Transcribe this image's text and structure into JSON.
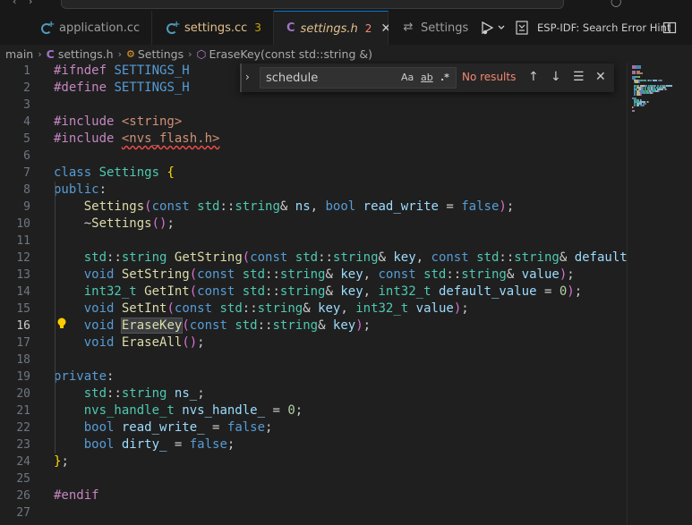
{
  "tabs": [
    {
      "label": "application.cc",
      "icon": "cpp-file-icon",
      "badge": ""
    },
    {
      "label": "settings.cc",
      "icon": "cpp-file-icon",
      "badge": "3"
    },
    {
      "label": "settings.h",
      "icon": "c-header-file-icon",
      "badge": "2",
      "active": true
    },
    {
      "label": "Settings",
      "icon": "settings-sliders-icon",
      "badge": ""
    }
  ],
  "header_icon_letter": "C",
  "toolbar": {
    "espidf_label": "ESP-IDF: Search Error Hint"
  },
  "breadcrumb": {
    "root": "main",
    "file": "settings.h",
    "class": "Settings",
    "member": "EraseKey(const std::string &)"
  },
  "find": {
    "query": "schedule",
    "result": "No results",
    "match_case": "Aa",
    "whole_word": "ab",
    "regex": ".*"
  },
  "editor": {
    "line_numbers": [
      "1",
      "2",
      "3",
      "4",
      "5",
      "6",
      "7",
      "8",
      "9",
      "10",
      "11",
      "12",
      "13",
      "14",
      "15",
      "16",
      "17",
      "18",
      "19",
      "20",
      "21",
      "22",
      "23",
      "24",
      "25",
      "26",
      "27"
    ],
    "current_line": 16,
    "lines": [
      [
        [
          "pp",
          "#ifndef "
        ],
        [
          "mac",
          "SETTINGS_H"
        ]
      ],
      [
        [
          "pp",
          "#define "
        ],
        [
          "mac",
          "SETTINGS_H"
        ]
      ],
      [],
      [
        [
          "pp",
          "#include "
        ],
        [
          "str",
          "<string>"
        ]
      ],
      [
        [
          "pp",
          "#include "
        ],
        [
          "str",
          "<nvs_flash.h>"
        ]
      ],
      [],
      [
        [
          "kw",
          "class "
        ],
        [
          "ty",
          "Settings "
        ],
        [
          "br1",
          "{"
        ]
      ],
      [
        [
          "kw",
          "public"
        ],
        [
          "plain",
          ":"
        ]
      ],
      [
        [
          "plain",
          "    "
        ],
        [
          "fn",
          "Settings"
        ],
        [
          "br2",
          "("
        ],
        [
          "kw",
          "const "
        ],
        [
          "ty",
          "std"
        ],
        [
          "plain",
          "::"
        ],
        [
          "ty",
          "string"
        ],
        [
          "plain",
          "& "
        ],
        [
          "var",
          "ns"
        ],
        [
          "plain",
          ", "
        ],
        [
          "kw",
          "bool "
        ],
        [
          "var",
          "read_write"
        ],
        [
          "plain",
          " = "
        ],
        [
          "kw",
          "false"
        ],
        [
          "br2",
          ")"
        ],
        [
          "plain",
          ";"
        ]
      ],
      [
        [
          "plain",
          "    ~"
        ],
        [
          "fn",
          "Settings"
        ],
        [
          "br2",
          "()"
        ],
        [
          "plain",
          ";"
        ]
      ],
      [],
      [
        [
          "plain",
          "    "
        ],
        [
          "ty",
          "std"
        ],
        [
          "plain",
          "::"
        ],
        [
          "ty",
          "string "
        ],
        [
          "fn",
          "GetString"
        ],
        [
          "br2",
          "("
        ],
        [
          "kw",
          "const "
        ],
        [
          "ty",
          "std"
        ],
        [
          "plain",
          "::"
        ],
        [
          "ty",
          "string"
        ],
        [
          "plain",
          "& "
        ],
        [
          "var",
          "key"
        ],
        [
          "plain",
          ", "
        ],
        [
          "kw",
          "const "
        ],
        [
          "ty",
          "std"
        ],
        [
          "plain",
          "::"
        ],
        [
          "ty",
          "string"
        ],
        [
          "plain",
          "& "
        ],
        [
          "var",
          "default_value"
        ]
      ],
      [
        [
          "plain",
          "    "
        ],
        [
          "kw",
          "void "
        ],
        [
          "fn",
          "SetString"
        ],
        [
          "br2",
          "("
        ],
        [
          "kw",
          "const "
        ],
        [
          "ty",
          "std"
        ],
        [
          "plain",
          "::"
        ],
        [
          "ty",
          "string"
        ],
        [
          "plain",
          "& "
        ],
        [
          "var",
          "key"
        ],
        [
          "plain",
          ", "
        ],
        [
          "kw",
          "const "
        ],
        [
          "ty",
          "std"
        ],
        [
          "plain",
          "::"
        ],
        [
          "ty",
          "string"
        ],
        [
          "plain",
          "& "
        ],
        [
          "var",
          "value"
        ],
        [
          "br2",
          ")"
        ],
        [
          "plain",
          ";"
        ]
      ],
      [
        [
          "plain",
          "    "
        ],
        [
          "ty",
          "int32_t "
        ],
        [
          "fn",
          "GetInt"
        ],
        [
          "br2",
          "("
        ],
        [
          "kw",
          "const "
        ],
        [
          "ty",
          "std"
        ],
        [
          "plain",
          "::"
        ],
        [
          "ty",
          "string"
        ],
        [
          "plain",
          "& "
        ],
        [
          "var",
          "key"
        ],
        [
          "plain",
          ", "
        ],
        [
          "ty",
          "int32_t "
        ],
        [
          "var",
          "default_value"
        ],
        [
          "plain",
          " = "
        ],
        [
          "num",
          "0"
        ],
        [
          "br2",
          ")"
        ],
        [
          "plain",
          ";"
        ]
      ],
      [
        [
          "plain",
          "    "
        ],
        [
          "kw",
          "void "
        ],
        [
          "fn",
          "SetInt"
        ],
        [
          "br2",
          "("
        ],
        [
          "kw",
          "const "
        ],
        [
          "ty",
          "std"
        ],
        [
          "plain",
          "::"
        ],
        [
          "ty",
          "string"
        ],
        [
          "plain",
          "& "
        ],
        [
          "var",
          "key"
        ],
        [
          "plain",
          ", "
        ],
        [
          "ty",
          "int32_t "
        ],
        [
          "var",
          "value"
        ],
        [
          "br2",
          ")"
        ],
        [
          "plain",
          ";"
        ]
      ],
      [
        [
          "plain",
          "    "
        ],
        [
          "kw",
          "void "
        ],
        [
          "fnhl",
          "EraseKey"
        ],
        [
          "br2",
          "("
        ],
        [
          "kw",
          "const "
        ],
        [
          "ty",
          "std"
        ],
        [
          "plain",
          "::"
        ],
        [
          "ty",
          "string"
        ],
        [
          "plain",
          "& "
        ],
        [
          "var",
          "key"
        ],
        [
          "br2",
          ")"
        ],
        [
          "plain",
          ";"
        ]
      ],
      [
        [
          "plain",
          "    "
        ],
        [
          "kw",
          "void "
        ],
        [
          "fn",
          "EraseAll"
        ],
        [
          "br2",
          "()"
        ],
        [
          "plain",
          ";"
        ]
      ],
      [],
      [
        [
          "kw",
          "private"
        ],
        [
          "plain",
          ":"
        ]
      ],
      [
        [
          "plain",
          "    "
        ],
        [
          "ty",
          "std"
        ],
        [
          "plain",
          "::"
        ],
        [
          "ty",
          "string "
        ],
        [
          "var",
          "ns_"
        ],
        [
          "plain",
          ";"
        ]
      ],
      [
        [
          "plain",
          "    "
        ],
        [
          "ty",
          "nvs_handle_t "
        ],
        [
          "var",
          "nvs_handle_"
        ],
        [
          "plain",
          " = "
        ],
        [
          "num",
          "0"
        ],
        [
          "plain",
          ";"
        ]
      ],
      [
        [
          "plain",
          "    "
        ],
        [
          "kw",
          "bool "
        ],
        [
          "var",
          "read_write_"
        ],
        [
          "plain",
          " = "
        ],
        [
          "kw",
          "false"
        ],
        [
          "plain",
          ";"
        ]
      ],
      [
        [
          "plain",
          "    "
        ],
        [
          "kw",
          "bool "
        ],
        [
          "var",
          "dirty_"
        ],
        [
          "plain",
          " = "
        ],
        [
          "kw",
          "false"
        ],
        [
          "plain",
          ";"
        ]
      ],
      [
        [
          "br1",
          "}"
        ],
        [
          "plain",
          ";"
        ]
      ],
      [],
      [
        [
          "pp",
          "#endif"
        ]
      ],
      []
    ]
  },
  "colors": {
    "accent": "#0078d4",
    "error": "#f48771",
    "warning": "#cca700",
    "modified_label": "#e2c08d"
  }
}
